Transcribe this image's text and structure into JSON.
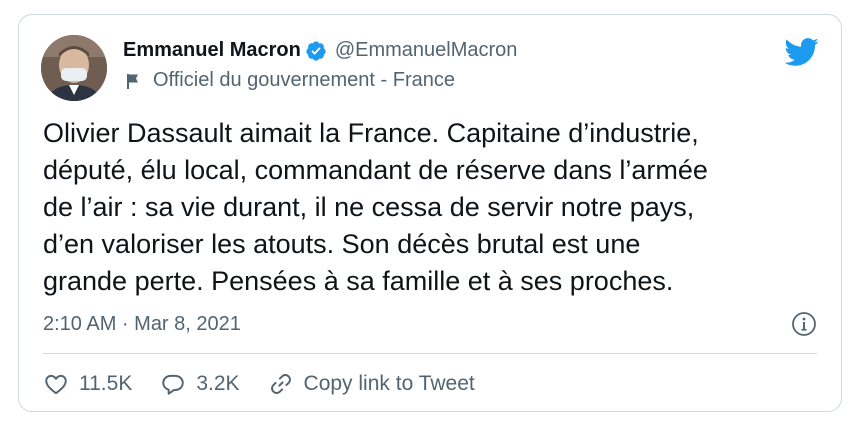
{
  "author": {
    "name": "Emmanuel Macron",
    "handle": "@EmmanuelMacron",
    "label": "Officiel du gouvernement - France",
    "avatar_icon": "profile-photo",
    "verified_icon": "verified-badge-icon"
  },
  "tweet": {
    "text": "Olivier Dassault aimait la France. Capitaine d’industrie,\ndéputé, élu local, commandant de réserve dans l’armée\nde l’air : sa vie durant, il ne cessa de servir notre pays,\nd’en valoriser les atouts. Son décès brutal est une\ngrande perte. Pensées à sa famille et à ses proches.",
    "timestamp": "2:10 AM · Mar 8, 2021"
  },
  "actions": {
    "likes": "11.5K",
    "replies": "3.2K",
    "copy_link": "Copy link to Tweet"
  },
  "colors": {
    "twitter_blue": "#1d9bf0",
    "text_primary": "#0f1419",
    "text_secondary": "#536471",
    "border": "#cfd9de"
  }
}
